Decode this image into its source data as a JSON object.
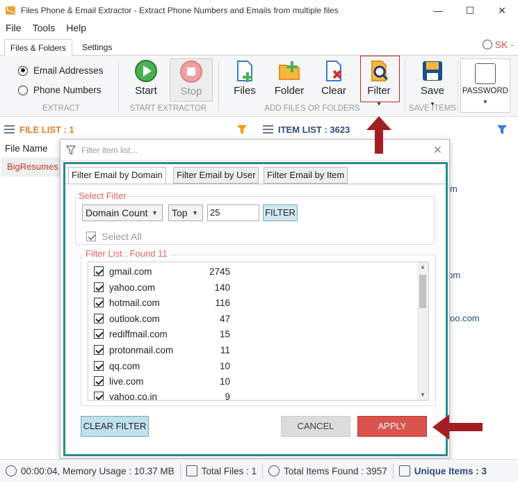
{
  "window": {
    "title": "Files Phone & Email Extractor - Extract Phone Numbers and Emails from multiple files",
    "minimize": "—",
    "maximize": "☐",
    "close": "✕"
  },
  "menu": [
    "File",
    "Tools",
    "Help"
  ],
  "tabs": [
    "Files & Folders",
    "Settings"
  ],
  "user": "SK -",
  "ribbon": {
    "extract": {
      "options": [
        "Email Addresses",
        "Phone Numbers"
      ],
      "selected": "Email Addresses",
      "label": "EXTRACT"
    },
    "start_extractor": {
      "start": "Start",
      "stop": "Stop",
      "label": "START EXTRACTOR"
    },
    "add_files": {
      "files": "Files",
      "folder": "Folder",
      "clear": "Clear",
      "filter": "Filter",
      "label": "ADD FILES OR FOLDERS"
    },
    "save_items": {
      "save": "Save",
      "label": "SAVE ITEMS"
    },
    "password": "PASSWORD"
  },
  "lists": {
    "file_list": "FILE LIST : 1",
    "item_list": "ITEM LIST : 3623",
    "file_name_header": "File Name",
    "file_row": "BigResumes",
    "bg_fragments": [
      "m",
      "om",
      "oo.com"
    ]
  },
  "popup": {
    "search_placeholder": "Filter item list...",
    "close": "✕",
    "tabs": [
      "Filter Email by Domain",
      "Filter Email by User",
      "Filter Email by Item"
    ],
    "select_filter_legend": "Select Filter",
    "sort_by": "Domain Count",
    "position": "Top",
    "count_value": "25",
    "filter_button": "FILTER",
    "select_all": "Select All",
    "filter_list_legend": "Filter List : Found 11",
    "items": [
      {
        "domain": "gmail.com",
        "count": "2745"
      },
      {
        "domain": "yahoo.com",
        "count": "140"
      },
      {
        "domain": "hotmail.com",
        "count": "116"
      },
      {
        "domain": "outlook.com",
        "count": "47"
      },
      {
        "domain": "rediffmail.com",
        "count": "15"
      },
      {
        "domain": "protonmail.com",
        "count": "11"
      },
      {
        "domain": "qq.com",
        "count": "10"
      },
      {
        "domain": "live.com",
        "count": "10"
      },
      {
        "domain": "yahoo.co.in",
        "count": "9"
      }
    ],
    "clear_filter": "CLEAR FILTER",
    "cancel": "CANCEL",
    "apply": "APPLY"
  },
  "status": {
    "time_memory": "00:00:04, Memory Usage : 10.37 MB",
    "total_files": "Total Files : 1",
    "total_items": "Total Items Found : 3957",
    "unique_items": "Unique Items : 3"
  },
  "colors": {
    "accent_red": "#d9534f",
    "teal_frame": "#2a8a8a",
    "orange": "#e67e22",
    "navy": "#2c4a7a"
  }
}
